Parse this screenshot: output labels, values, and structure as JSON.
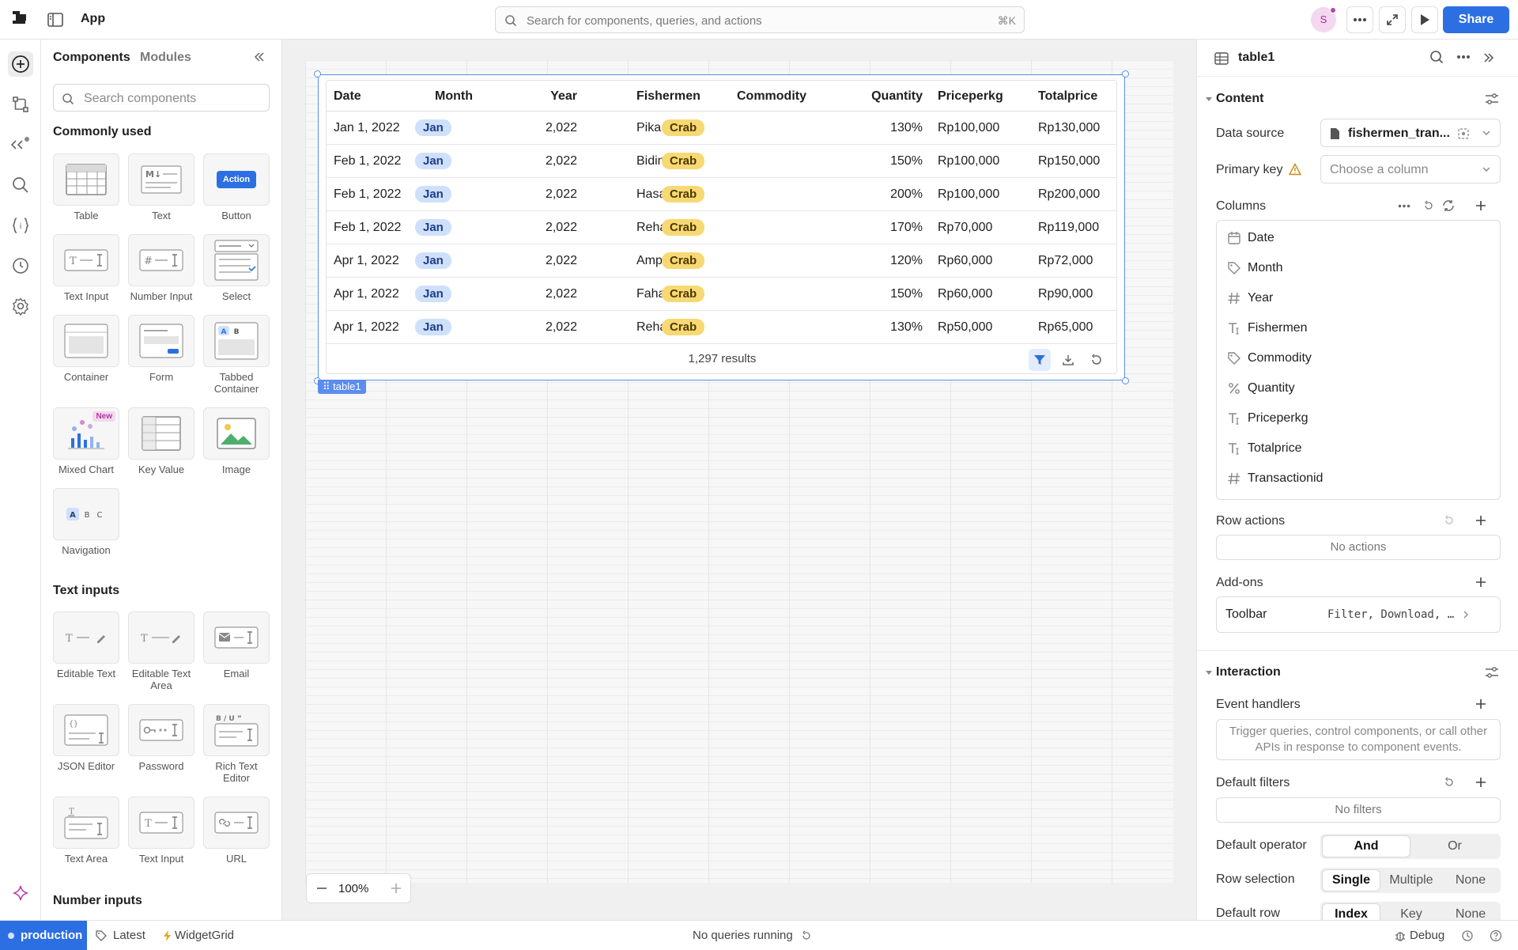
{
  "topbar": {
    "app_title": "App",
    "search_placeholder": "Search for components, queries, and actions",
    "search_shortcut": "⌘K",
    "avatar_initial": "S",
    "share_label": "Share"
  },
  "components_panel": {
    "tabs": [
      "Components",
      "Modules"
    ],
    "search_placeholder": "Search components",
    "sections": {
      "common": "Commonly used",
      "text_inputs": "Text inputs",
      "number_inputs": "Number inputs"
    },
    "common_items": [
      "Table",
      "Text",
      "Button",
      "Text Input",
      "Number Input",
      "Select",
      "Container",
      "Form",
      "Tabbed Container",
      "Mixed Chart",
      "Key Value",
      "Image",
      "Navigation"
    ],
    "text_input_items": [
      "Editable Text",
      "Editable Text Area",
      "Email",
      "JSON Editor",
      "Password",
      "Rich Text Editor",
      "Text Area",
      "Text Input",
      "URL"
    ],
    "button_preview": "Action",
    "new_badge": "New",
    "text_preview": "M↓",
    "tab_preview": [
      "A",
      "B"
    ],
    "nav_preview": [
      "A",
      "B",
      "C"
    ]
  },
  "table": {
    "component_name": "table1",
    "columns": [
      "Date",
      "Month",
      "Year",
      "Fishermen",
      "Commodity",
      "Quantity",
      "Priceperkg",
      "Totalprice"
    ],
    "rows": [
      [
        "Jan 1, 2022",
        "Jan",
        "2,022",
        "Pika",
        "Crab",
        "130%",
        "Rp100,000",
        "Rp130,000"
      ],
      [
        "Feb 1, 2022",
        "Jan",
        "2,022",
        "Bidin",
        "Crab",
        "150%",
        "Rp100,000",
        "Rp150,000"
      ],
      [
        "Feb 1, 2022",
        "Jan",
        "2,022",
        "Hasan",
        "Crab",
        "200%",
        "Rp100,000",
        "Rp200,000"
      ],
      [
        "Feb 1, 2022",
        "Jan",
        "2,022",
        "Rehan",
        "Crab",
        "170%",
        "Rp70,000",
        "Rp119,000"
      ],
      [
        "Apr 1, 2022",
        "Jan",
        "2,022",
        "Ampe",
        "Crab",
        "120%",
        "Rp60,000",
        "Rp72,000"
      ],
      [
        "Apr 1, 2022",
        "Jan",
        "2,022",
        "Fahasan",
        "Crab",
        "150%",
        "Rp60,000",
        "Rp90,000"
      ],
      [
        "Apr 1, 2022",
        "Jan",
        "2,022",
        "Rehan",
        "Crab",
        "130%",
        "Rp50,000",
        "Rp65,000"
      ]
    ],
    "results": "1,297 results"
  },
  "canvas": {
    "zoom": "100%"
  },
  "inspector": {
    "title": "table1",
    "content_section": "Content",
    "data_source_label": "Data source",
    "data_source_value": "fishermen_tran...",
    "primary_key_label": "Primary key",
    "primary_key_placeholder": "Choose a column",
    "columns_label": "Columns",
    "columns": [
      {
        "name": "Date",
        "icon": "calendar-icon"
      },
      {
        "name": "Month",
        "icon": "tag-icon"
      },
      {
        "name": "Year",
        "icon": "hash-icon"
      },
      {
        "name": "Fishermen",
        "icon": "text-icon"
      },
      {
        "name": "Commodity",
        "icon": "tag-icon"
      },
      {
        "name": "Quantity",
        "icon": "percent-icon"
      },
      {
        "name": "Priceperkg",
        "icon": "text-icon"
      },
      {
        "name": "Totalprice",
        "icon": "text-icon"
      },
      {
        "name": "Transactionid",
        "icon": "hash-icon"
      }
    ],
    "row_actions_label": "Row actions",
    "row_actions_empty": "No actions",
    "addons_label": "Add-ons",
    "toolbar_label": "Toolbar",
    "toolbar_value": "Filter, Download, …",
    "interaction_section": "Interaction",
    "event_handlers_label": "Event handlers",
    "event_handlers_hint": "Trigger queries, control components, or call other APIs in response to component events.",
    "default_filters_label": "Default filters",
    "default_filters_empty": "No filters",
    "default_operator_label": "Default operator",
    "operator_options": [
      "And",
      "Or"
    ],
    "row_selection_label": "Row selection",
    "row_selection_options": [
      "Single",
      "Multiple",
      "None"
    ],
    "default_row_label": "Default row",
    "default_row_options": [
      "Index",
      "Key",
      "None"
    ]
  },
  "statusbar": {
    "environment": "production",
    "version": "Latest",
    "widget": "WidgetGrid",
    "queries": "No queries running",
    "debug": "Debug"
  },
  "colors": {
    "accent": "#2c6fe2",
    "selection": "#5b8def",
    "pill_blue": "#cfe0fb",
    "pill_yellow": "#f7d873"
  }
}
